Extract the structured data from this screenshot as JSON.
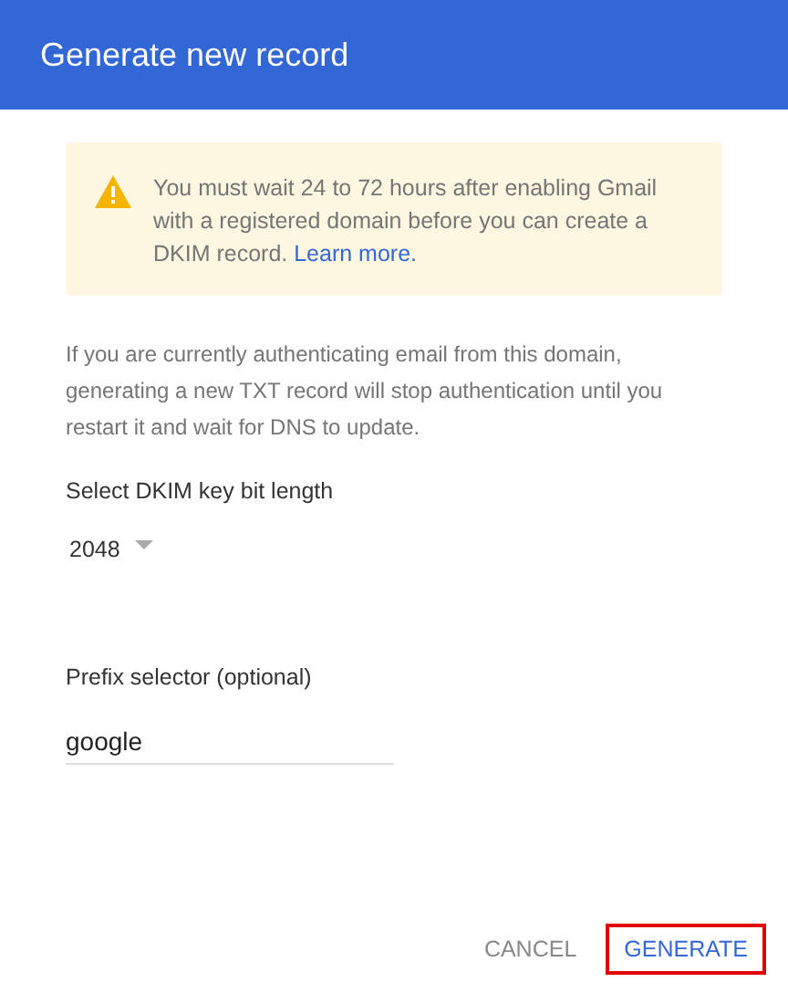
{
  "dialog": {
    "title": "Generate new record"
  },
  "warning": {
    "text": "You must wait 24 to 72 hours after enabling Gmail with a registered domain before you can create a DKIM record.",
    "link": "Learn more."
  },
  "description": "If you are currently authenticating email from this domain, generating a new TXT record will stop authentication until you restart it and wait for DNS to update.",
  "key_length": {
    "label": "Select DKIM key bit length",
    "value": "2048"
  },
  "prefix": {
    "label": "Prefix selector (optional)",
    "value": "google"
  },
  "buttons": [
    {
      "label": "CANCEL",
      "kind": "secondary",
      "highlighted": false
    },
    {
      "label": "GENERATE",
      "kind": "primary",
      "highlighted": true
    }
  ]
}
